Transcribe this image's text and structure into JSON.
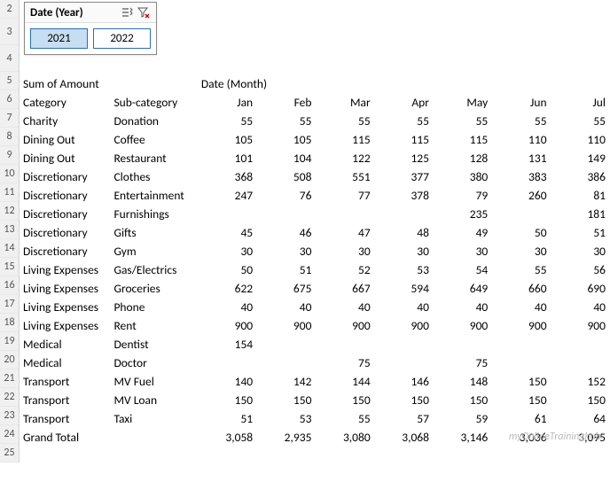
{
  "slicer": {
    "title": "Date (Year)",
    "items": [
      "2021",
      "2022"
    ],
    "selected": "2021"
  },
  "rowNumbers": [
    2,
    3,
    4,
    5,
    6,
    7,
    8,
    9,
    10,
    11,
    12,
    13,
    14,
    15,
    16,
    17,
    18,
    19,
    20,
    21,
    22,
    23,
    24,
    25
  ],
  "header": {
    "measure": "Sum of Amount",
    "colField": "Date (Month)",
    "catLabel": "Category",
    "subLabel": "Sub-category",
    "months": [
      "Jan",
      "Feb",
      "Mar",
      "Apr",
      "May",
      "Jun",
      "Jul"
    ]
  },
  "rows": [
    {
      "cat": "Charity",
      "sub": "Donation",
      "v": [
        "55",
        "55",
        "55",
        "55",
        "55",
        "55",
        "55"
      ]
    },
    {
      "cat": "Dining Out",
      "sub": "Coffee",
      "v": [
        "105",
        "105",
        "115",
        "115",
        "115",
        "110",
        "110"
      ]
    },
    {
      "cat": "Dining Out",
      "sub": "Restaurant",
      "v": [
        "101",
        "104",
        "122",
        "125",
        "128",
        "131",
        "149"
      ]
    },
    {
      "cat": "Discretionary",
      "sub": "Clothes",
      "v": [
        "368",
        "508",
        "551",
        "377",
        "380",
        "383",
        "386"
      ]
    },
    {
      "cat": "Discretionary",
      "sub": "Entertainment",
      "v": [
        "247",
        "76",
        "77",
        "378",
        "79",
        "260",
        "81"
      ]
    },
    {
      "cat": "Discretionary",
      "sub": "Furnishings",
      "v": [
        "",
        "",
        "",
        "",
        "235",
        "",
        "181"
      ]
    },
    {
      "cat": "Discretionary",
      "sub": "Gifts",
      "v": [
        "45",
        "46",
        "47",
        "48",
        "49",
        "50",
        "51"
      ]
    },
    {
      "cat": "Discretionary",
      "sub": "Gym",
      "v": [
        "30",
        "30",
        "30",
        "30",
        "30",
        "30",
        "30"
      ]
    },
    {
      "cat": "Living Expenses",
      "sub": "Gas/Electrics",
      "v": [
        "50",
        "51",
        "52",
        "53",
        "54",
        "55",
        "56"
      ]
    },
    {
      "cat": "Living Expenses",
      "sub": "Groceries",
      "v": [
        "622",
        "675",
        "667",
        "594",
        "649",
        "660",
        "690"
      ]
    },
    {
      "cat": "Living Expenses",
      "sub": "Phone",
      "v": [
        "40",
        "40",
        "40",
        "40",
        "40",
        "40",
        "40"
      ]
    },
    {
      "cat": "Living Expenses",
      "sub": "Rent",
      "v": [
        "900",
        "900",
        "900",
        "900",
        "900",
        "900",
        "900"
      ]
    },
    {
      "cat": "Medical",
      "sub": "Dentist",
      "v": [
        "154",
        "",
        "",
        "",
        "",
        "",
        ""
      ]
    },
    {
      "cat": "Medical",
      "sub": "Doctor",
      "v": [
        "",
        "",
        "75",
        "",
        "75",
        "",
        ""
      ]
    },
    {
      "cat": "Transport",
      "sub": "MV Fuel",
      "v": [
        "140",
        "142",
        "144",
        "146",
        "148",
        "150",
        "152"
      ]
    },
    {
      "cat": "Transport",
      "sub": "MV Loan",
      "v": [
        "150",
        "150",
        "150",
        "150",
        "150",
        "150",
        "150"
      ]
    },
    {
      "cat": "Transport",
      "sub": "Taxi",
      "v": [
        "51",
        "53",
        "55",
        "57",
        "59",
        "61",
        "64"
      ]
    }
  ],
  "total": {
    "label": "Grand Total",
    "v": [
      "3,058",
      "2,935",
      "3,080",
      "3,068",
      "3,146",
      "3,036",
      "3,095"
    ]
  },
  "watermark": "myOnlineTraininghub"
}
